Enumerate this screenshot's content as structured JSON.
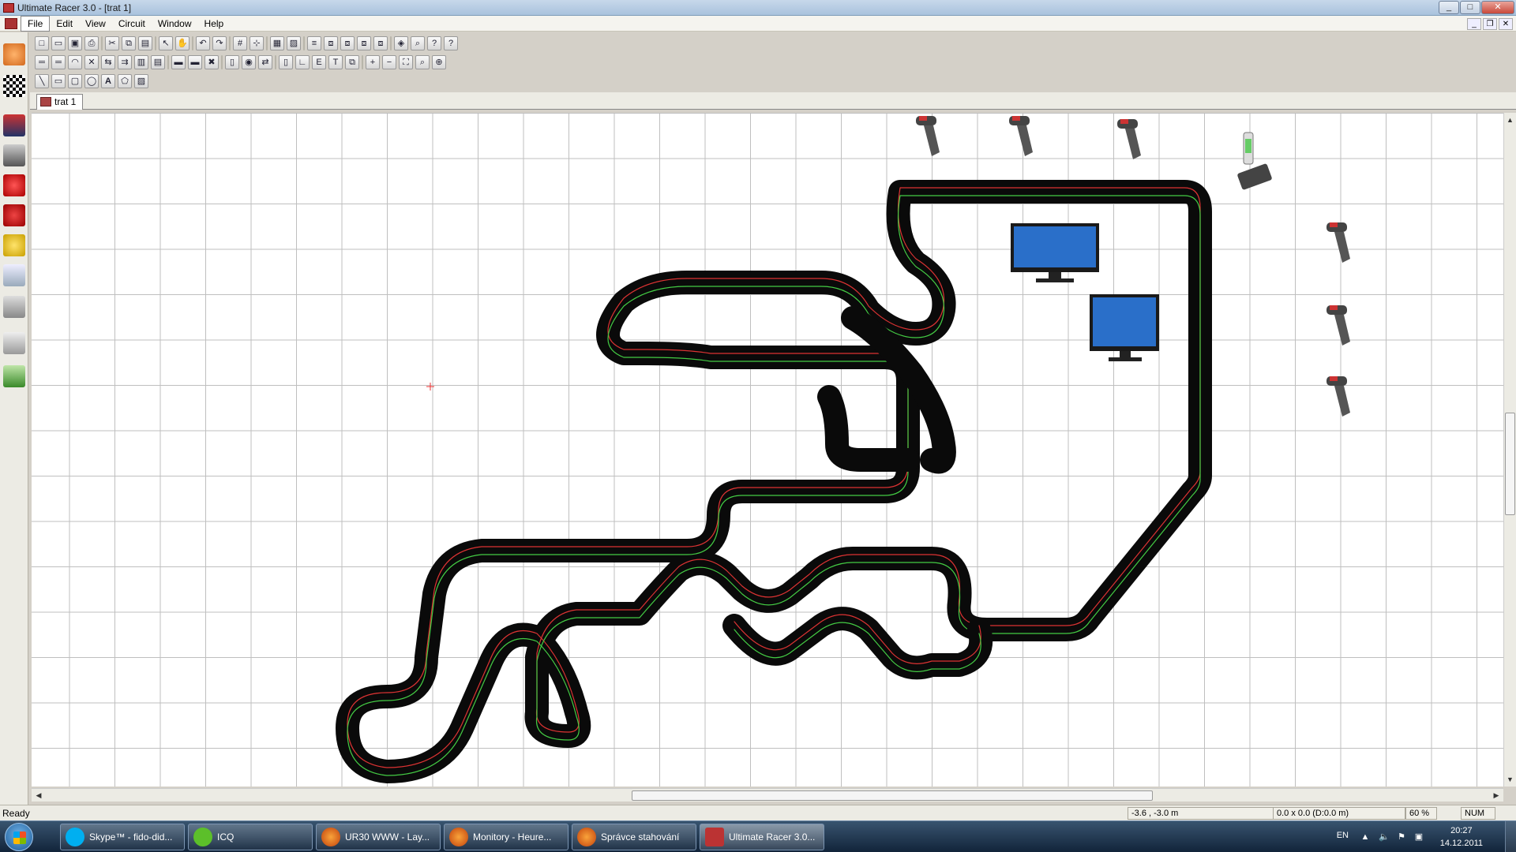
{
  "window": {
    "title": "Ultimate Racer 3.0 - [trat 1]"
  },
  "menu": {
    "items": [
      "File",
      "Edit",
      "View",
      "Circuit",
      "Window",
      "Help"
    ]
  },
  "document_tab": {
    "label": "trat 1"
  },
  "status": {
    "ready": "Ready",
    "coordinates": "-3.6 , -3.0 m",
    "size": "0.0 x 0.0  (D:0.0 m)",
    "zoom": "60 %",
    "num_lock": "NUM"
  },
  "taskbar": {
    "tasks": [
      {
        "label": "Skype™ - fido-did...",
        "icon": "skype-icon",
        "color": "#00aff0"
      },
      {
        "label": "ICQ",
        "icon": "icq-flower-icon",
        "color": "#5cbf2a"
      },
      {
        "label": "UR30 WWW - Lay...",
        "icon": "firefox-icon",
        "color": "#e66000"
      },
      {
        "label": "Monitory - Heure...",
        "icon": "firefox-icon",
        "color": "#e66000"
      },
      {
        "label": "Správce stahování",
        "icon": "firefox-icon",
        "color": "#e66000"
      },
      {
        "label": "Ultimate Racer 3.0...",
        "icon": "ultimate-racer-icon",
        "color": "#b33333"
      }
    ],
    "language": "EN",
    "time": "20:27",
    "date": "14.12.2011"
  },
  "canvas": {
    "grid": true,
    "objects": [
      "slot-car-track",
      "hand-controller",
      "lap-counter-device",
      "monitor"
    ]
  }
}
